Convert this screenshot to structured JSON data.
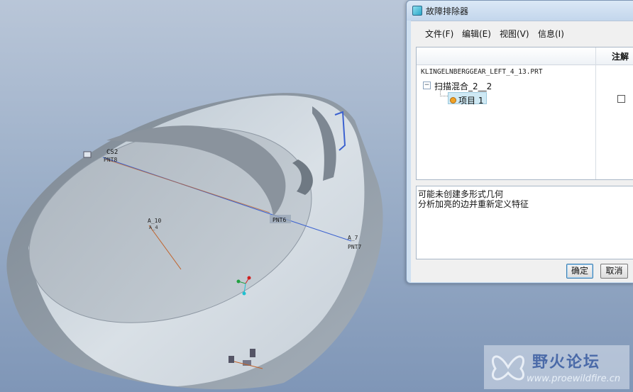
{
  "viewport": {
    "labels": {
      "cs2": "CS2",
      "pnt8": "PNT8",
      "pnt6": "PNT6",
      "pnt7": "PNT7",
      "a10": "A_10",
      "a4": "A_4",
      "a7": "A_7"
    }
  },
  "dialog": {
    "title": "故障排除器",
    "menu": {
      "file": "文件(F)",
      "edit": "编辑(E)",
      "view": "视图(V)",
      "info": "信息(I)"
    },
    "tree": {
      "column_notes": "注解",
      "filename": "KLINGELNBERGGEAR_LEFT_4_13.PRT",
      "expand_symbol": "−",
      "node1": "扫描混合_2__2",
      "node2": "项目 1"
    },
    "message_lines": [
      "可能未创建多形式几何",
      "分析加亮的边并重新定义特征"
    ],
    "buttons": {
      "ok": "确定",
      "cancel": "取消"
    }
  },
  "watermark": {
    "title": "野火论坛",
    "url": "www.proewildfire.cn"
  },
  "colors": {
    "dialog_frame": "#cfe0f1",
    "selection": "#cfe9f4",
    "datum_orange": "#c0622a",
    "edge_blue": "#3c62d0"
  }
}
